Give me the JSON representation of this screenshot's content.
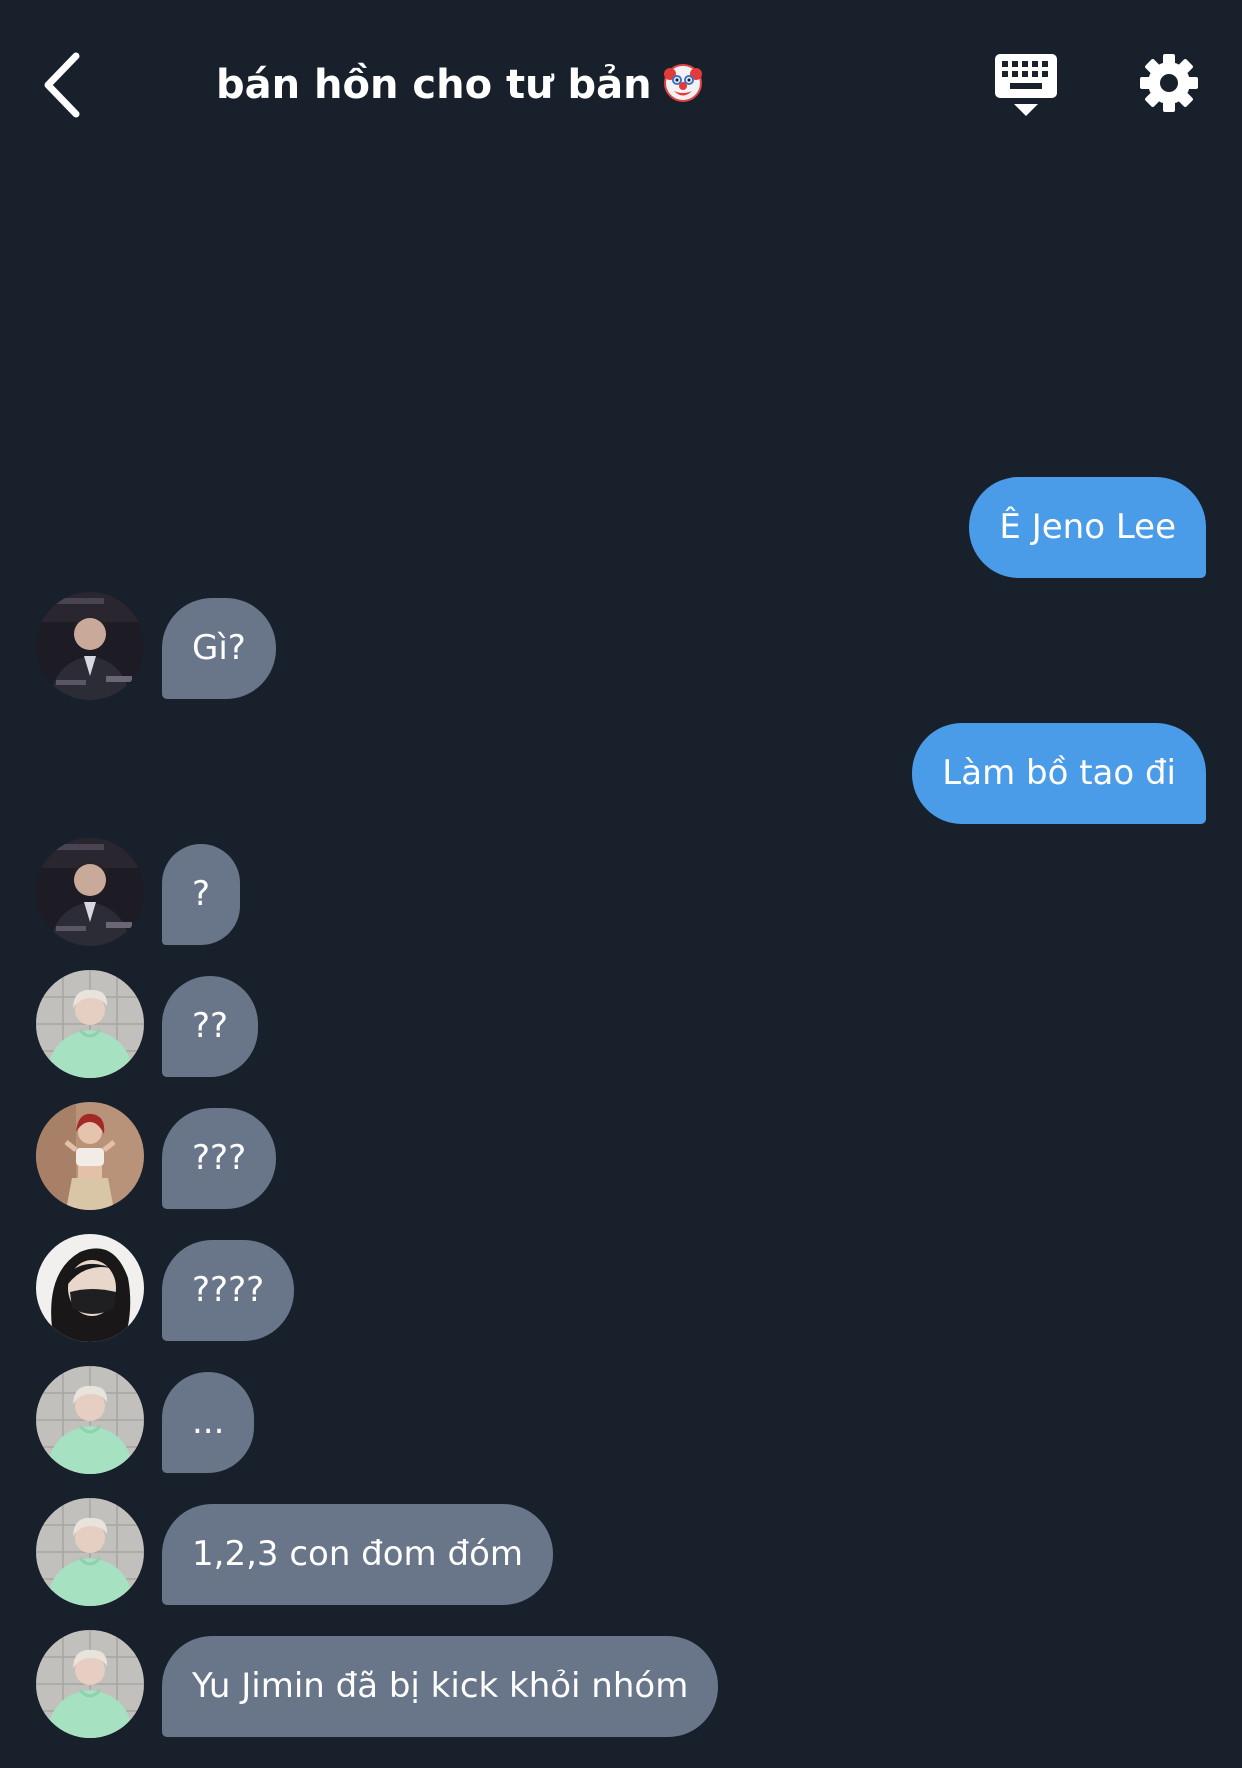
{
  "header": {
    "title": "bán hồn cho tư bản",
    "title_emoji_icon": "clown-face-icon",
    "back_icon": "chevron-left-icon",
    "keyboard_icon": "keyboard-icon",
    "settings_icon": "gear-icon"
  },
  "colors": {
    "background": "#18202b",
    "outgoing_bubble": "#4a9be8",
    "incoming_bubble": "#69768a",
    "text": "#ffffff"
  },
  "messages": [
    {
      "direction": "outgoing",
      "text": "Ê Jeno Lee"
    },
    {
      "direction": "incoming",
      "avatar": "avatar-suit",
      "text": "Gì?"
    },
    {
      "direction": "outgoing",
      "text": "Làm bồ tao đi"
    },
    {
      "direction": "incoming",
      "avatar": "avatar-suit",
      "text": "?"
    },
    {
      "direction": "incoming",
      "avatar": "avatar-green-hoodie",
      "text": "??"
    },
    {
      "direction": "incoming",
      "avatar": "avatar-red-hair",
      "text": "???"
    },
    {
      "direction": "incoming",
      "avatar": "avatar-black-mask",
      "text": "????"
    },
    {
      "direction": "incoming",
      "avatar": "avatar-green-hoodie",
      "text": "..."
    },
    {
      "direction": "incoming",
      "avatar": "avatar-green-hoodie",
      "text": "1,2,3 con đom đóm"
    },
    {
      "direction": "incoming",
      "avatar": "avatar-green-hoodie",
      "text": "Yu Jimin đã bị kick khỏi nhóm"
    }
  ]
}
